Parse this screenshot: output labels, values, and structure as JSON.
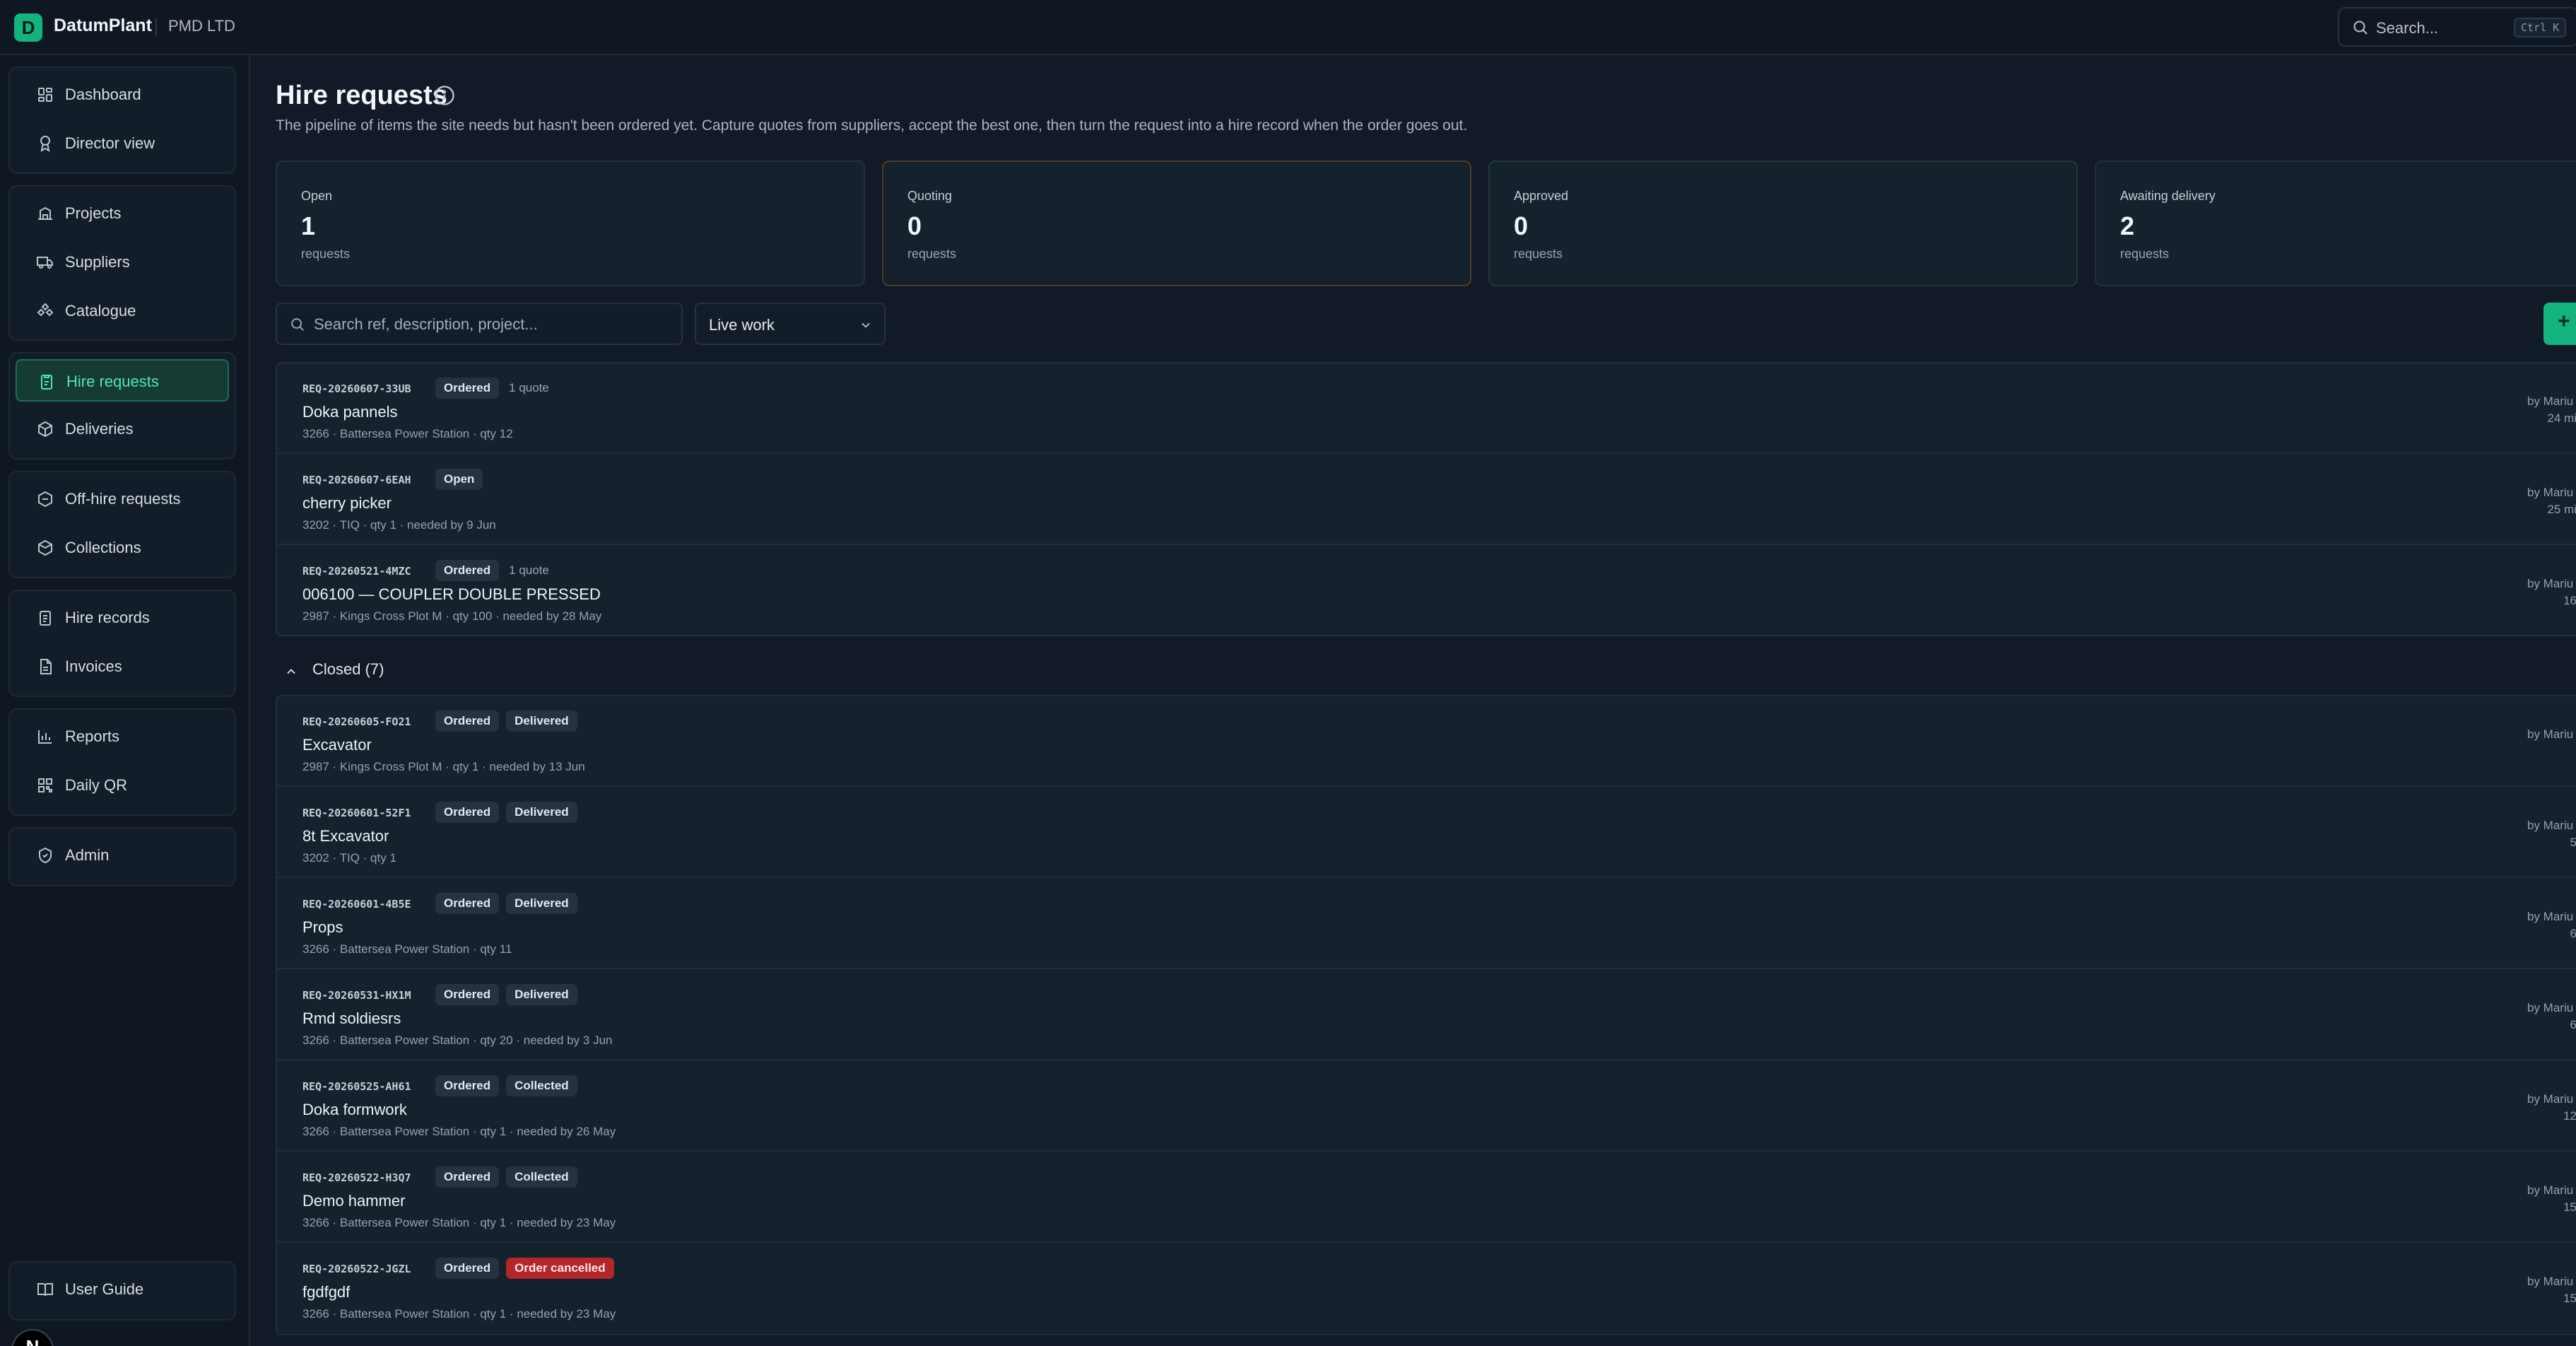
{
  "app": {
    "brand": "DatumPlant",
    "logo_letter": "D",
    "org": "PMD LTD"
  },
  "global_search": {
    "placeholder": "Search...",
    "shortcut": "Ctrl K"
  },
  "sidebar": {
    "groups": [
      [
        {
          "label": "Dashboard",
          "icon": "dashboard-icon"
        },
        {
          "label": "Director view",
          "icon": "award-icon"
        }
      ],
      [
        {
          "label": "Projects",
          "icon": "projects-icon"
        },
        {
          "label": "Suppliers",
          "icon": "truck-icon"
        },
        {
          "label": "Catalogue",
          "icon": "catalogue-icon"
        }
      ],
      [
        {
          "label": "Hire requests",
          "icon": "clipboard-icon",
          "active": true
        },
        {
          "label": "Deliveries",
          "icon": "package-icon"
        }
      ],
      [
        {
          "label": "Off-hire requests",
          "icon": "off-hire-icon"
        },
        {
          "label": "Collections",
          "icon": "collections-icon"
        }
      ],
      [
        {
          "label": "Hire records",
          "icon": "records-icon"
        },
        {
          "label": "Invoices",
          "icon": "invoice-icon"
        }
      ],
      [
        {
          "label": "Reports",
          "icon": "bar-chart-icon"
        },
        {
          "label": "Daily QR",
          "icon": "qr-icon"
        }
      ],
      [
        {
          "label": "Admin",
          "icon": "shield-icon"
        }
      ]
    ],
    "user_guide": "User Guide",
    "avatar_letter": "N"
  },
  "page": {
    "title": "Hire requests",
    "description": "The pipeline of items the site needs but hasn't been ordered yet. Capture quotes from suppliers, accept the best one, then turn the request into a hire record when the order goes out."
  },
  "stats": [
    {
      "label": "Open",
      "value": "1",
      "unit": "requests"
    },
    {
      "label": "Quoting",
      "value": "0",
      "unit": "requests"
    },
    {
      "label": "Approved",
      "value": "0",
      "unit": "requests"
    },
    {
      "label": "Awaiting delivery",
      "value": "2",
      "unit": "requests"
    }
  ],
  "filters": {
    "search_placeholder": "Search ref, description, project...",
    "scope_value": "Live work",
    "new_button": "+"
  },
  "open_requests": [
    {
      "ref": "REQ-20260607-33UB",
      "badges": [
        "Ordered"
      ],
      "note": "1 quote",
      "title": "Doka pannels",
      "meta": "3266 · Battersea Power Station · qty 12",
      "by": "by Mariu",
      "age": "24 mi"
    },
    {
      "ref": "REQ-20260607-6EAH",
      "badges": [
        "Open"
      ],
      "note": "",
      "title": "cherry picker",
      "meta": "3202 · TIQ · qty 1 · needed by 9 Jun",
      "by": "by Mariu",
      "age": "25 mi"
    },
    {
      "ref": "REQ-20260521-4MZC",
      "badges": [
        "Ordered"
      ],
      "note": "1 quote",
      "title": "006100 — COUPLER DOUBLE PRESSED",
      "meta": "2987 · Kings Cross Plot M · qty 100 · needed by 28 May",
      "by": "by Mariu",
      "age": "16"
    }
  ],
  "closed_section": {
    "label": "Closed (7)"
  },
  "closed_requests": [
    {
      "ref": "REQ-20260605-FO21",
      "badges": [
        "Ordered",
        "Delivered"
      ],
      "title": "Excavator",
      "meta": "2987 · Kings Cross Plot M · qty 1 · needed by 13 Jun",
      "by": "by Mariu",
      "age": ""
    },
    {
      "ref": "REQ-20260601-52F1",
      "badges": [
        "Ordered",
        "Delivered"
      ],
      "title": "8t Excavator",
      "meta": "3202 · TIQ · qty 1",
      "by": "by Mariu",
      "age": "5"
    },
    {
      "ref": "REQ-20260601-4B5E",
      "badges": [
        "Ordered",
        "Delivered"
      ],
      "title": "Props",
      "meta": "3266 · Battersea Power Station · qty 11",
      "by": "by Mariu",
      "age": "6"
    },
    {
      "ref": "REQ-20260531-HX1M",
      "badges": [
        "Ordered",
        "Delivered"
      ],
      "title": "Rmd soldiesrs",
      "meta": "3266 · Battersea Power Station · qty 20 · needed by 3 Jun",
      "by": "by Mariu",
      "age": "6"
    },
    {
      "ref": "REQ-20260525-AH61",
      "badges": [
        "Ordered",
        "Collected"
      ],
      "title": "Doka formwork",
      "meta": "3266 · Battersea Power Station · qty 1 · needed by 26 May",
      "by": "by Mariu",
      "age": "12"
    },
    {
      "ref": "REQ-20260522-H3Q7",
      "badges": [
        "Ordered",
        "Collected"
      ],
      "title": "Demo hammer",
      "meta": "3266 · Battersea Power Station · qty 1 · needed by 23 May",
      "by": "by Mariu",
      "age": "15"
    },
    {
      "ref": "REQ-20260522-JGZL",
      "badges": [
        "Ordered",
        "Order cancelled"
      ],
      "title": "fgdfgdf",
      "meta": "3266 · Battersea Power Station · qty 1 · needed by 23 May",
      "by": "by Mariu",
      "age": "15"
    }
  ],
  "colors": {
    "accent": "#12b37c",
    "active_text": "#4ee6b0",
    "cancelled": "#b3262a",
    "background": "#111a26"
  }
}
